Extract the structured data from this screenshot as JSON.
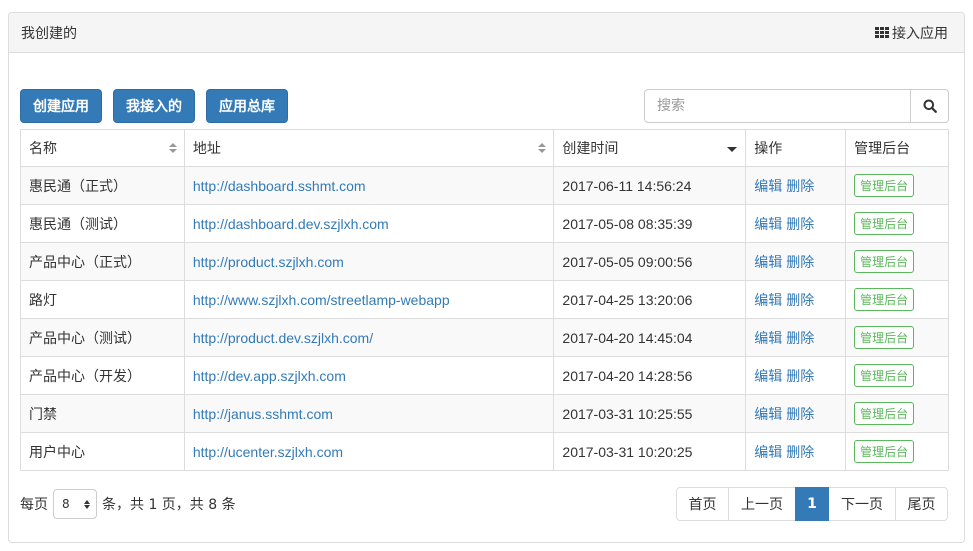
{
  "header": {
    "title": "我创建的",
    "connect_label": "接入应用"
  },
  "toolbar": {
    "create_label": "创建应用",
    "joined_label": "我接入的",
    "library_label": "应用总库"
  },
  "search": {
    "placeholder": "搜索",
    "value": ""
  },
  "table": {
    "columns": [
      "名称",
      "地址",
      "创建时间",
      "操作",
      "管理后台"
    ],
    "sort": {
      "column": "创建时间",
      "direction": "desc"
    },
    "edit_label": "编辑",
    "delete_label": "删除",
    "admin_label": "管理后台",
    "rows": [
      {
        "name": "惠民通（正式）",
        "url": "http://dashboard.sshmt.com",
        "created": "2017-06-11 14:56:24"
      },
      {
        "name": "惠民通（测试）",
        "url": "http://dashboard.dev.szjlxh.com",
        "created": "2017-05-08 08:35:39"
      },
      {
        "name": "产品中心（正式）",
        "url": "http://product.szjlxh.com",
        "created": "2017-05-05 09:00:56"
      },
      {
        "name": "路灯",
        "url": "http://www.szjlxh.com/streetlamp-webapp",
        "created": "2017-04-25 13:20:06"
      },
      {
        "name": "产品中心（测试）",
        "url": "http://product.dev.szjlxh.com/",
        "created": "2017-04-20 14:45:04"
      },
      {
        "name": "产品中心（开发）",
        "url": "http://dev.app.szjlxh.com",
        "created": "2017-04-20 14:28:56"
      },
      {
        "name": "门禁",
        "url": "http://janus.sshmt.com",
        "created": "2017-03-31 10:25:55"
      },
      {
        "name": "用户中心",
        "url": "http://ucenter.szjlxh.com",
        "created": "2017-03-31 10:20:25"
      }
    ]
  },
  "footer": {
    "per_page_prefix": "每页",
    "page_size": "8",
    "summary": "条，共 1 页，共 8 条",
    "pagination": {
      "first": "首页",
      "prev": "上一页",
      "current": "1",
      "next": "下一页",
      "last": "尾页"
    }
  },
  "colors": {
    "primary": "#337ab7",
    "admin_badge": "#5cb85c",
    "stripe": "#f9f9f9"
  },
  "icons": {
    "connect": "grid-icon",
    "search": "search-icon",
    "sort_both": "sort-icon",
    "sort_desc": "sort-desc-icon"
  }
}
